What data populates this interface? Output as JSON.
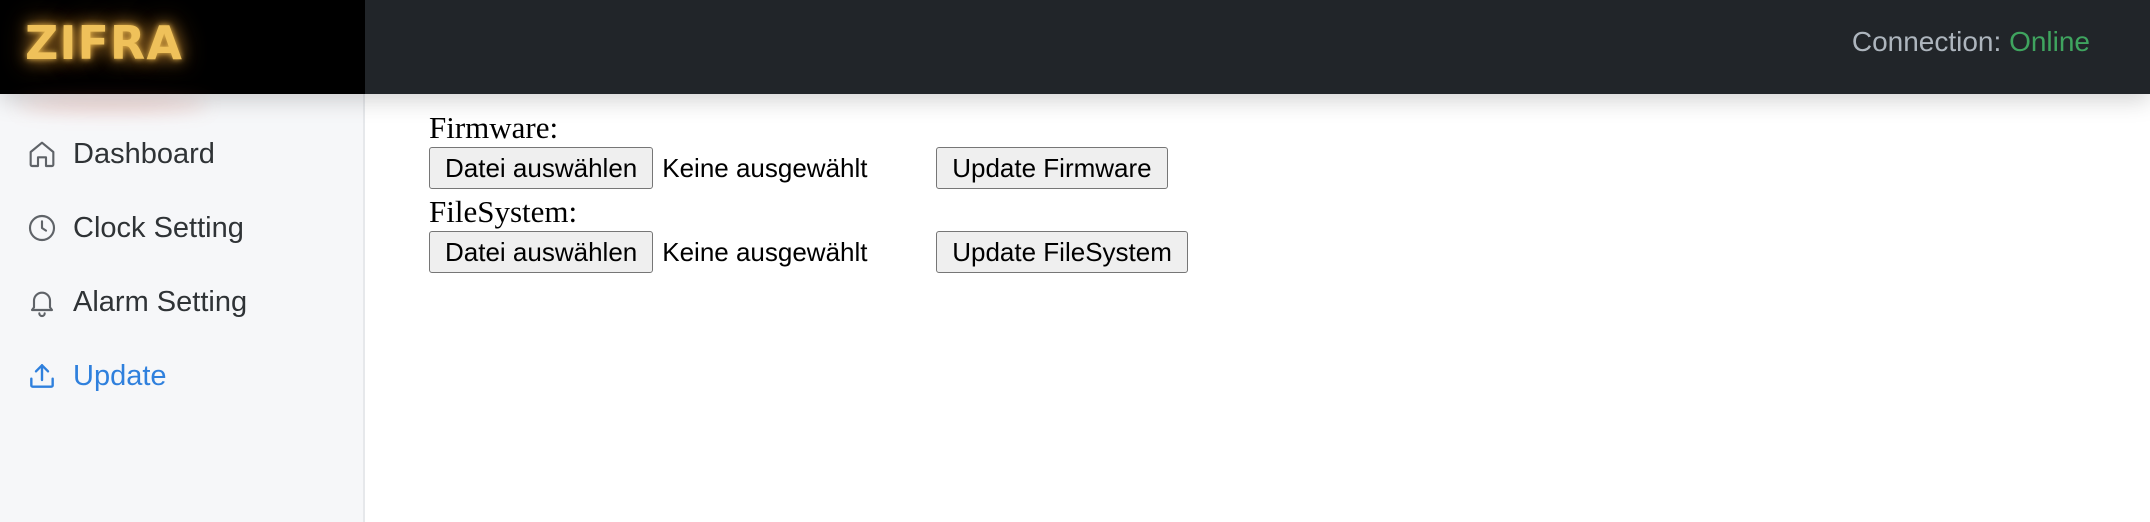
{
  "header": {
    "brand": "ZIFRA",
    "connection_label": "Connection:",
    "connection_status": "Online"
  },
  "sidebar": {
    "items": [
      {
        "label": "Dashboard",
        "icon": "home-icon",
        "active": false
      },
      {
        "label": "Clock Setting",
        "icon": "clock-icon",
        "active": false
      },
      {
        "label": "Alarm Setting",
        "icon": "bell-icon",
        "active": false
      },
      {
        "label": "Update",
        "icon": "upload-icon",
        "active": true
      }
    ]
  },
  "main": {
    "firmware": {
      "label": "Firmware:",
      "choose_button": "Datei auswählen",
      "file_status": "Keine ausgewählt",
      "update_button": "Update Firmware"
    },
    "filesystem": {
      "label": "FileSystem:",
      "choose_button": "Datei auswählen",
      "file_status": "Keine ausgewählt",
      "update_button": "Update FileSystem"
    }
  },
  "colors": {
    "header_bg": "#212529",
    "brand_bg": "#000000",
    "brand_text": "#efc15a",
    "status_online": "#3fa45f",
    "nav_active": "#2f80dd",
    "sidebar_bg": "#f6f7f9"
  }
}
